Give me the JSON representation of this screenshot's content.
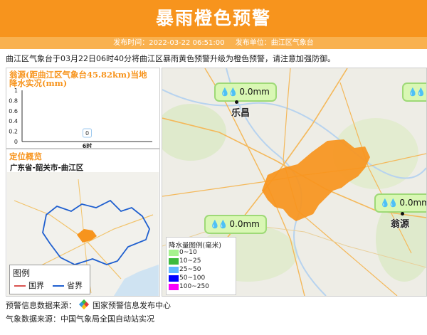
{
  "header": {
    "title": "暴雨橙色预警",
    "publish_time_label": "发布时间：2022-03-22 06:51:00",
    "publisher_label": "发布单位：曲江区气象台"
  },
  "description": "曲江区气象台于03月22日06时40分将曲江区暴雨黄色预警升级为橙色预警，请注意加强防御。",
  "rain_chart": {
    "title": "翁源(距曲江区气象台45.82km)当地降水实况(mm)",
    "chart_data": {
      "type": "bar",
      "categories": [
        "6时"
      ],
      "values": [
        0
      ],
      "data_labels": [
        "0"
      ],
      "ylim": [
        0,
        1
      ],
      "yticks": [
        "1",
        "0.8",
        "0.6",
        "0.4",
        "0.2",
        "0"
      ],
      "title": "翁源(距曲江区气象台45.82km)当地降水实况(mm)"
    }
  },
  "location": {
    "title": "定位概览",
    "region": "广东省-韶关市-曲江区"
  },
  "map_legend": {
    "title": "图例",
    "items": [
      {
        "label": "国界",
        "color": "#d9534f"
      },
      {
        "label": "省界",
        "color": "#1f5fcf"
      }
    ]
  },
  "rain_legend": {
    "title": "降水量图例(毫米)",
    "items": [
      {
        "label": "0~10",
        "color": "#a6f28f"
      },
      {
        "label": "10~25",
        "color": "#3dba3d"
      },
      {
        "label": "25~50",
        "color": "#61b8ff"
      },
      {
        "label": "50~100",
        "color": "#0000ff"
      },
      {
        "label": "100~250",
        "color": "#fa00fa"
      }
    ]
  },
  "stations": [
    {
      "value": "0.0mm"
    },
    {
      "value": "0.0mm"
    },
    {
      "value": "0.0mm"
    },
    {
      "value": ""
    }
  ],
  "cities": {
    "lechang": "乐昌",
    "wengyuan": "翁源"
  },
  "footer": {
    "warning_source": "预警信息数据来源：",
    "warning_source_name": "国家预警信息发布中心",
    "weather_source": "气象数据来源：中国气象局全国自动站实况"
  },
  "colors": {
    "accent": "#f7941d",
    "warning_area": "#f7941d"
  }
}
